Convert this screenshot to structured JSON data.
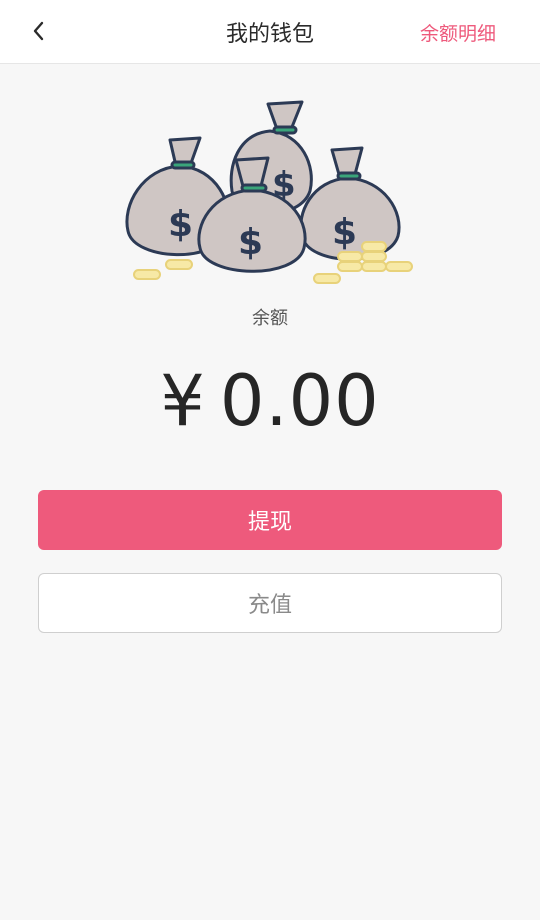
{
  "header": {
    "title": "我的钱包",
    "detail_label": "余额明细",
    "back_icon": "chevron-left-icon"
  },
  "wallet": {
    "illustration_icon": "money-bags-icon",
    "balance_label": "余额",
    "currency_symbol": "¥",
    "balance_value": "0.00"
  },
  "actions": {
    "withdraw_label": "提现",
    "recharge_label": "充值"
  },
  "colors": {
    "accent": "#ee5a7c",
    "background": "#f7f7f7"
  }
}
